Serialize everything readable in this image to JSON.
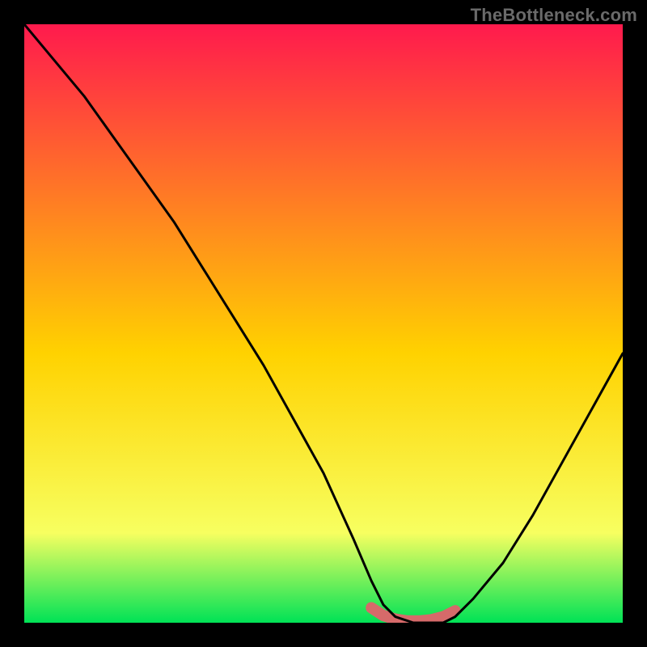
{
  "watermark": "TheBottleneck.com",
  "chart_data": {
    "type": "line",
    "title": "",
    "xlabel": "",
    "ylabel": "",
    "xlim": [
      0,
      100
    ],
    "ylim": [
      0,
      100
    ],
    "grid": false,
    "legend": false,
    "background_gradient": {
      "top": "#ff1a4d",
      "mid": "#ffd200",
      "low": "#f7ff60",
      "bottom": "#00e256"
    },
    "series": [
      {
        "name": "curve",
        "color": "#000000",
        "x": [
          0,
          5,
          10,
          15,
          20,
          25,
          30,
          35,
          40,
          45,
          50,
          55,
          58,
          60,
          62,
          65,
          68,
          70,
          72,
          75,
          80,
          85,
          90,
          95,
          100
        ],
        "values": [
          100,
          94,
          88,
          81,
          74,
          67,
          59,
          51,
          43,
          34,
          25,
          14,
          7,
          3,
          1,
          0,
          0,
          0,
          1,
          4,
          10,
          18,
          27,
          36,
          45
        ]
      },
      {
        "name": "trough-marker",
        "color": "#d66a6a",
        "x": [
          58,
          60,
          62,
          64,
          66,
          68,
          70,
          72
        ],
        "values": [
          2.5,
          1.2,
          0.6,
          0.3,
          0.3,
          0.5,
          1.0,
          2.0
        ]
      }
    ],
    "annotations": []
  }
}
